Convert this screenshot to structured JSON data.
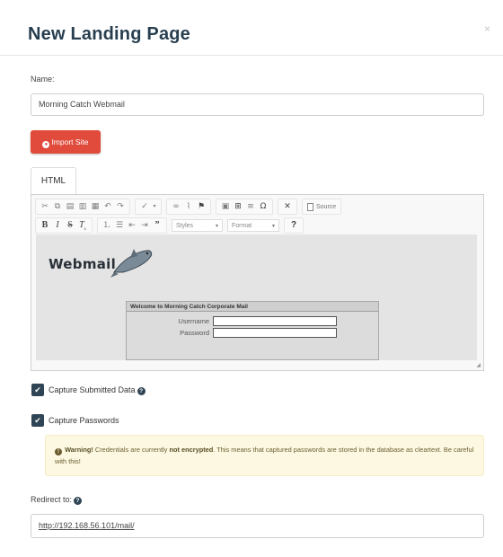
{
  "modal": {
    "title": "New Landing Page",
    "close_label": "×"
  },
  "form": {
    "name_label": "Name:",
    "name_value": "Morning Catch Webmail",
    "import_button": "Import Site",
    "tabs": [
      {
        "label": "HTML",
        "active": true
      }
    ],
    "editor": {
      "toolbar_row1": [
        "cut",
        "copy",
        "paste",
        "paste-text",
        "paste-word",
        "undo",
        "redo",
        "spellcheck",
        "link",
        "unlink",
        "anchor",
        "image",
        "table",
        "horizontal-rule",
        "special-char",
        "maximize",
        "source"
      ],
      "source_label": "Source",
      "toolbar_row2": [
        "bold",
        "italic",
        "strike",
        "remove-format",
        "numbered-list",
        "bulleted-list",
        "outdent",
        "indent",
        "blockquote",
        "styles",
        "format",
        "help"
      ],
      "styles_label": "Styles",
      "format_label": "Format",
      "help_label": "?",
      "content": {
        "logo_text": "Webmail",
        "panel_title": "Welcome to Morning Catch Corporate Mail",
        "username_label": "Username",
        "password_label": "Password"
      }
    },
    "capture_data_label": "Capture Submitted Data",
    "capture_passwords_label": "Capture Passwords",
    "warning": {
      "strong": "Warning!",
      "text": " Credentials are currently ",
      "em": "not encrypted",
      "rest": ". This means that captured passwords are stored in the database as cleartext. Be careful with this!"
    },
    "redirect_label": "Redirect to:",
    "redirect_value": "http://192.168.56.101/mail/"
  },
  "colors": {
    "title": "#283f50",
    "danger": "#e04b3c",
    "checkbox": "#2f4454",
    "warning_bg": "#fdf8e2"
  }
}
